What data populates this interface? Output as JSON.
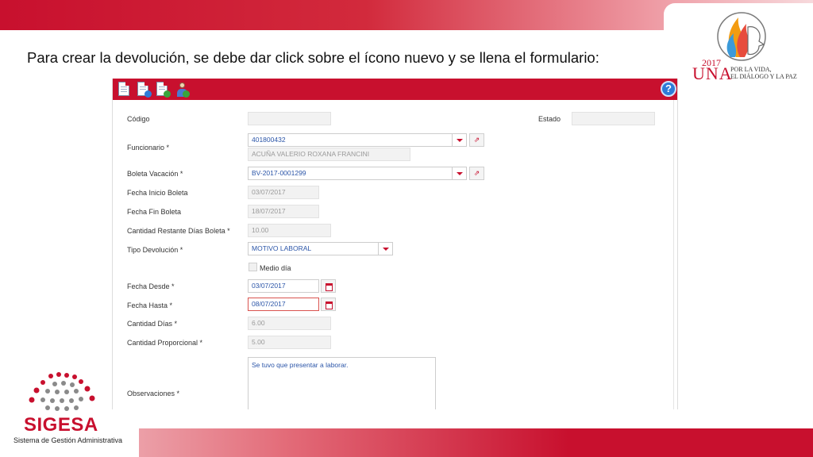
{
  "slide": {
    "instruction": "Para crear la devolución, se debe dar click sobre el ícono nuevo y se llena el formulario:"
  },
  "una_logo": {
    "year": "2017",
    "name": "UNA",
    "tagline_1": "POR LA VIDA,",
    "tagline_2": "EL DIÁLOGO Y LA PAZ"
  },
  "sigesa_logo": {
    "name": "SIGESA",
    "subtitle": "Sistema de Gestión Administrativa"
  },
  "toolbar": {
    "buttons": [
      "new-document-icon",
      "add-document-icon",
      "refresh-document-icon",
      "add-person-icon"
    ],
    "help_label": "?"
  },
  "form": {
    "codigo": {
      "label": "Código",
      "value": ""
    },
    "estado": {
      "label": "Estado",
      "value": ""
    },
    "funcionario": {
      "label": "Funcionario *",
      "value": "401800432",
      "name": "ACUÑA VALERIO ROXANA FRANCINI"
    },
    "boleta_vacacion": {
      "label": "Boleta Vacación *",
      "value": "BV-2017-0001299"
    },
    "fecha_inicio_boleta": {
      "label": "Fecha Inicio Boleta",
      "value": "03/07/2017"
    },
    "fecha_fin_boleta": {
      "label": "Fecha Fin Boleta",
      "value": "18/07/2017"
    },
    "cantidad_restante": {
      "label": "Cantidad Restante Días Boleta *",
      "value": "10.00"
    },
    "tipo_devolucion": {
      "label": "Tipo Devolución *",
      "value": "MOTIVO LABORAL"
    },
    "medio_dia": {
      "label": "Medio día",
      "checked": false
    },
    "fecha_desde": {
      "label": "Fecha Desde *",
      "value": "03/07/2017"
    },
    "fecha_hasta": {
      "label": "Fecha Hasta *",
      "value": "08/07/2017"
    },
    "cantidad_dias": {
      "label": "Cantidad Días *",
      "value": "6.00"
    },
    "cantidad_proporcional": {
      "label": "Cantidad Proporcional *",
      "value": "5.00"
    },
    "observaciones": {
      "label": "Observaciones *",
      "value": "Se tuvo que presentar a laborar."
    }
  },
  "colors": {
    "brand_red": "#c8102e",
    "input_text_blue": "#2b55a8",
    "help_blue": "#2e7bd8"
  }
}
